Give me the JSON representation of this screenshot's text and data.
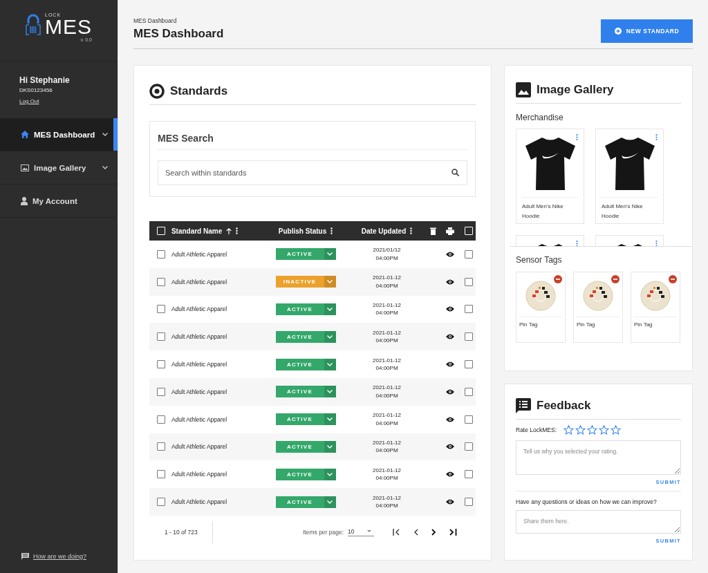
{
  "sidebar": {
    "logo": {
      "small": "LOCK",
      "big": "MES",
      "version": "v. 0.0"
    },
    "user": {
      "greeting": "Hi Stephanie",
      "id": "DKS0123456",
      "logout": "Log Out"
    },
    "items": [
      {
        "label": "MES Dashboard",
        "kind": "home",
        "expandable": true,
        "selected": true
      },
      {
        "label": "Image Gallery",
        "kind": "image",
        "expandable": true,
        "selected": false
      },
      {
        "label": "My Account",
        "kind": "person",
        "expandable": false,
        "selected": false
      }
    ],
    "feedback_link": "How are we doing?"
  },
  "header": {
    "breadcrumb": "MES Dashboard",
    "title": "MES Dashboard",
    "button": "NEW STANDARD"
  },
  "standards": {
    "title": "Standards",
    "search": {
      "title": "MES Search",
      "placeholder": "Search within standards"
    },
    "table": {
      "columns": [
        "Standard Name",
        "Publish Status",
        "Date Updated"
      ],
      "all_checked": false,
      "bulk_checked": false,
      "rows": [
        {
          "name": "Adult Athletic Apparel",
          "status": "ACTIVE",
          "active": true,
          "date": "2021/01/12",
          "time": "04:00PM",
          "checked": false,
          "selected": false
        },
        {
          "name": "Adult Athletic Apparel",
          "status": "INACTIVE",
          "active": false,
          "date": "2021-01-12",
          "time": "04:00PM",
          "checked": false,
          "selected": false
        },
        {
          "name": "Adult Athletic Apparel",
          "status": "ACTIVE",
          "active": true,
          "date": "2021-01-12",
          "time": "04:00PM",
          "checked": false,
          "selected": false
        },
        {
          "name": "Adult Athletic Apparel",
          "status": "ACTIVE",
          "active": true,
          "date": "2021-01-12",
          "time": "04:00PM",
          "checked": false,
          "selected": false
        },
        {
          "name": "Adult Athletic Apparel",
          "status": "ACTIVE",
          "active": true,
          "date": "2021-01-12",
          "time": "04:00PM",
          "checked": false,
          "selected": false
        },
        {
          "name": "Adult Athletic Apparel",
          "status": "ACTIVE",
          "active": true,
          "date": "2021-01-12",
          "time": "04:00PM",
          "checked": false,
          "selected": false
        },
        {
          "name": "Adult Athletic Apparel",
          "status": "ACTIVE",
          "active": true,
          "date": "2021-01-12",
          "time": "04:00PM",
          "checked": false,
          "selected": false
        },
        {
          "name": "Adult Athletic Apparel",
          "status": "ACTIVE",
          "active": true,
          "date": "2021-01-12",
          "time": "04:00PM",
          "checked": false,
          "selected": false
        },
        {
          "name": "Adult Athletic Apparel",
          "status": "ACTIVE",
          "active": true,
          "date": "2021-01-12",
          "time": "04:00PM",
          "checked": false,
          "selected": false
        },
        {
          "name": "Adult Athletic Apparel",
          "status": "ACTIVE",
          "active": true,
          "date": "2021-01-12",
          "time": "04:00PM",
          "checked": false,
          "selected": false
        }
      ]
    },
    "pagination": {
      "range": "1 - 10 of 723",
      "per_page_label": "Items per page:",
      "per_page": "10"
    }
  },
  "gallery": {
    "title": "Image Gallery",
    "merch_title": "Merchandise",
    "merch": [
      {
        "kind": "full",
        "caption": "Adult Men's Nike Hoodie"
      },
      {
        "kind": "full",
        "caption": "Adult Men's Nike Hoodie"
      },
      {
        "kind": "partial"
      },
      {
        "kind": "partial"
      }
    ],
    "tags_title": "Sensor Tags",
    "tags": [
      {
        "caption": "Pin Tag"
      },
      {
        "caption": "Pin Tag"
      },
      {
        "caption": "Pin Tag"
      }
    ]
  },
  "feedback": {
    "title": "Feedback",
    "rate_label": "Rate LockMES:",
    "stars": 0,
    "reason_placeholder": "Tell us why you selected your rating.",
    "submit": "SUBMIT",
    "question": "Have any questions or ideas on how we can improve?",
    "ideas_placeholder": "Share them here.",
    "submit2": "SUBMIT"
  }
}
